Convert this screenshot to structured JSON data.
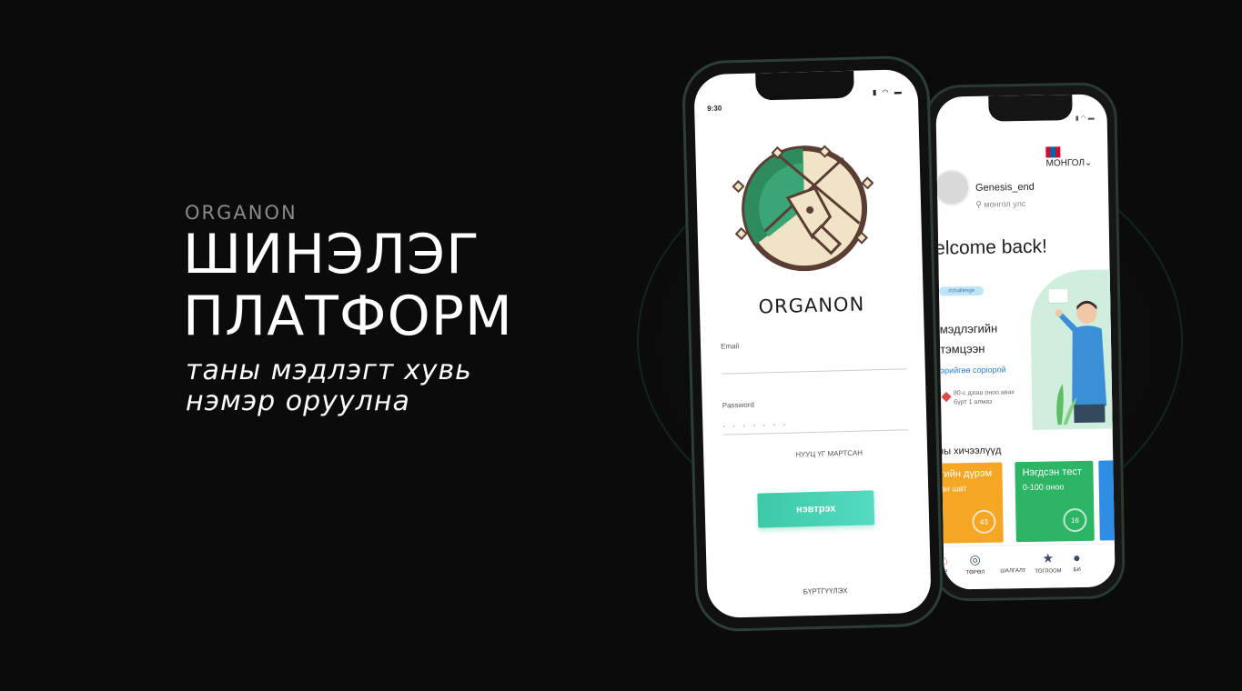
{
  "hero": {
    "brand_small": "ORGANON",
    "headline_1": "ШИНЭЛЭГ",
    "headline_2": "ПЛАТФОРМ",
    "tagline_1": "таны мэдлэгт хувь",
    "tagline_2": "нэмэр оруулна"
  },
  "login_screen": {
    "time": "9:30",
    "logo_text": "ORGANON",
    "email_label": "Email",
    "password_label": "Password",
    "password_mask": "• • • • • • •",
    "forgot_link": "НУУЦ ҮГ МАРТСАН",
    "login_button": "нэвтрэх",
    "register_link": "БҮРТГҮҮЛЭХ",
    "colors": {
      "accent": "#3cc9a8",
      "logo_green": "#2e8b5e",
      "logo_cream": "#f1e4c6",
      "logo_brown": "#5a3e33"
    }
  },
  "home_screen": {
    "language": "МОНГОЛ",
    "username": "Genesis_end",
    "location": "монгол улс",
    "welcome": "elcome back!",
    "chip": "#challenge",
    "hero_title_1": "мэдлэгийн",
    "hero_title_2": "тэмцээн",
    "hero_link": "эрийгөө сорiорой",
    "hero_note_1": "80-с дээш оноо авах",
    "hero_note_2": "бүрт 1 алмаз",
    "lessons_title": "ны хичээлүүд",
    "cards": [
      {
        "title": "гийн дүрэм",
        "subtitle": "ан шат",
        "score": "43"
      },
      {
        "title": "Нэгдсэн тест",
        "subtitle": "0-100 оноо",
        "score": "16"
      }
    ],
    "tabs": [
      "ҮР",
      "ТӨРӨЛ",
      "ШАЛГАЛТ",
      "ТОГЛООМ",
      "БИ"
    ],
    "colors": {
      "card_orange": "#f5a623",
      "card_green": "#2db566",
      "card_blue": "#2f8de4"
    }
  }
}
